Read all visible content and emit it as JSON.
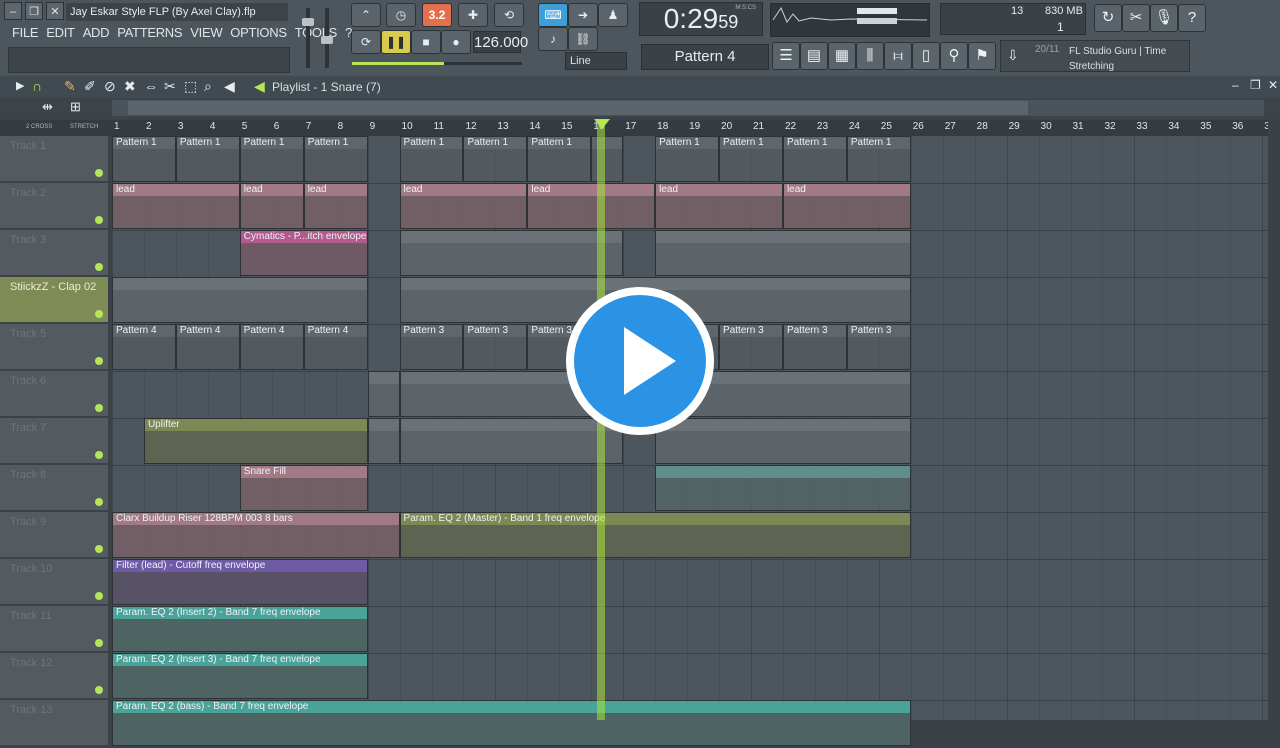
{
  "window": {
    "filename": "Jay Eskar Style FLP (By Axel Clay).flp"
  },
  "menu": [
    "FILE",
    "EDIT",
    "ADD",
    "PATTERNS",
    "VIEW",
    "OPTIONS",
    "TOOLS",
    "?"
  ],
  "transport": {
    "tempo": "126.000",
    "time": "0:29",
    "time_small": "59",
    "time_unit": "M:S:CS",
    "snap": "Line",
    "pattern": "Pattern 4",
    "step": "3.2"
  },
  "cpu": {
    "value": "13",
    "memory": "830 MB",
    "polyphony": "1"
  },
  "hint": {
    "counter": "20/11",
    "text": "FL Studio Guru | Time Stretching"
  },
  "playlist": {
    "title": "Playlist - 1 Snare (7)",
    "crossfade_label": "2 CROSS",
    "stretch_label": "STRETCH"
  },
  "ruler": [
    "1",
    "2",
    "3",
    "4",
    "5",
    "6",
    "7",
    "8",
    "9",
    "10",
    "11",
    "12",
    "13",
    "14",
    "15",
    "16",
    "17",
    "18",
    "19",
    "20",
    "21",
    "22",
    "23",
    "24",
    "25",
    "26",
    "27",
    "28",
    "29",
    "30",
    "31",
    "32",
    "33",
    "34",
    "35",
    "36",
    "3"
  ],
  "tracks": [
    {
      "name": "Track 1"
    },
    {
      "name": "Track 2"
    },
    {
      "name": "Track 3"
    },
    {
      "name": "StiickzZ - Clap 02"
    },
    {
      "name": "Track 5"
    },
    {
      "name": "Track 6"
    },
    {
      "name": "Track 7"
    },
    {
      "name": "Track 8"
    },
    {
      "name": "Track 9"
    },
    {
      "name": "Track 10"
    },
    {
      "name": "Track 11"
    },
    {
      "name": "Track 12"
    },
    {
      "name": "Track 13"
    }
  ],
  "clips": {
    "pattern1": "Pattern 1",
    "pattern3": "Pattern 3",
    "pattern4": "Pattern 4",
    "lead": "lead",
    "cymatics": "Cymatics - P...itch envelope",
    "uplifter": "Uplifter",
    "snare_fill": "Snare Fill",
    "riser": "Clarx Buildup Riser 128BPM 003 8 bars",
    "eq_master": "Param. EQ 2 (Master) - Band 1 freq envelope",
    "filter_lead": "Filter (lead) - Cutoff freq envelope",
    "eq_insert2": "Param. EQ 2 (Insert 2) - Band 7 freq envelope",
    "eq_insert3": "Param. EQ 2 (Insert 3) - Band 7 freq envelope",
    "eq_bass": "Param. EQ 2 (bass) - Band 7 freq envelope"
  },
  "icons": {
    "play": "play-icon",
    "stop": "stop-icon",
    "record": "record-icon",
    "help": "help-icon"
  }
}
